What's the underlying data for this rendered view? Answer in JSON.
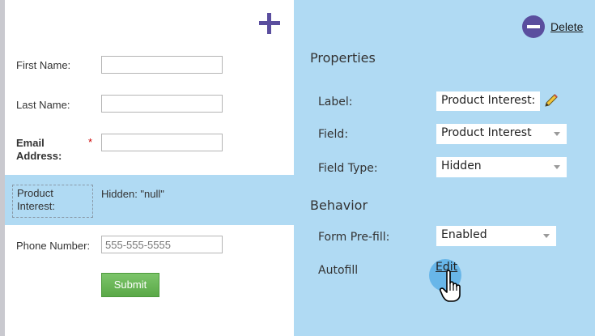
{
  "form": {
    "fields": [
      {
        "label": "First Name:",
        "value": ""
      },
      {
        "label": "Last Name:",
        "value": ""
      },
      {
        "label": "Email Address:",
        "label_line1": "Email",
        "label_line2": "Address:",
        "required_mark": "*",
        "value": ""
      },
      {
        "label": "Phone Number:",
        "value": "",
        "placeholder": "555-555-5555"
      }
    ],
    "hidden_field": {
      "label_line1": "Product",
      "label_line2": "Interest:",
      "value_text": "Hidden: \"null\""
    },
    "submit_label": "Submit",
    "add_icon": "plus-icon"
  },
  "properties": {
    "delete_label": "Delete",
    "delete_icon": "minus-circle-icon",
    "section_title": "Properties",
    "label_label": "Label:",
    "label_value": "Product Interest:",
    "edit_icon": "pencil-icon",
    "field_label": "Field:",
    "field_value": "Product Interest",
    "field_type_label": "Field Type:",
    "field_type_value": "Hidden"
  },
  "behavior": {
    "section_title": "Behavior",
    "prefill_label": "Form Pre-fill:",
    "prefill_value": "Enabled",
    "autofill_label": "Autofill",
    "autofill_edit_label": "Edit",
    "cursor_icon": "hand-pointer-icon"
  },
  "colors": {
    "accent_purple": "#5a4e9e",
    "panel_blue": "#b0daf3",
    "submit_green": "#5aa847",
    "required_red": "#cc0000"
  }
}
